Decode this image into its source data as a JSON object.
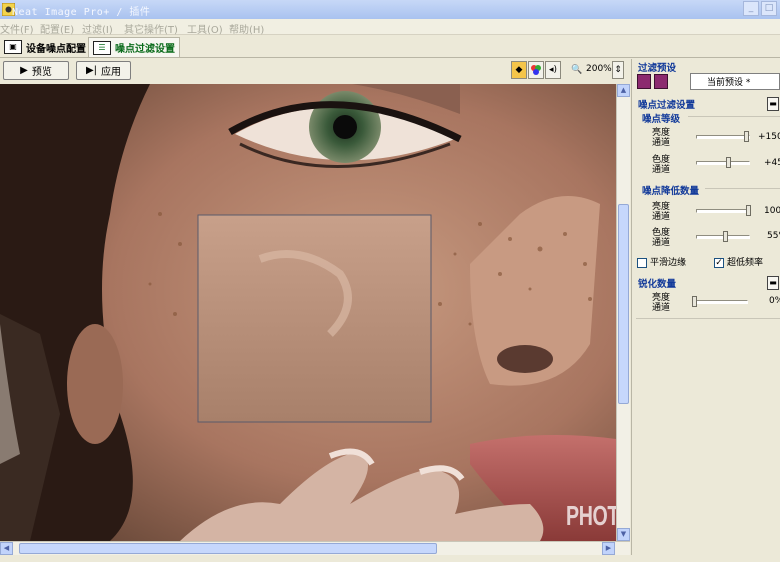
{
  "window": {
    "title": "Neat Image Pro+ / 插件",
    "minimize": "_",
    "maximize": "□"
  },
  "menu": [
    "文件(F)",
    "配置(E)",
    "过滤(I)",
    "其它操作(T)",
    "工具(O)",
    "帮助(H)"
  ],
  "tabs": [
    {
      "label": "设备噪点配置",
      "active": false
    },
    {
      "label": "噪点过滤设置",
      "active": true
    }
  ],
  "toolbar": {
    "preview_label": "预览",
    "apply_label": "应用",
    "zoom": "200%"
  },
  "panel": {
    "preset_title": "过滤预设",
    "preset_value": "当前预设 *",
    "filter_title": "噪点过滤设置",
    "noise_level_title": "噪点等级",
    "noise_level": [
      {
        "label": "亮度\n通道",
        "value_text": "+150%",
        "position": 0.9
      },
      {
        "label": "色度\n通道",
        "value_text": "+45%",
        "position": 0.55
      }
    ],
    "noise_reduction_title": "噪点降低数量",
    "noise_reduction": [
      {
        "label": "亮度\n通道",
        "value_text": "100%",
        "position": 0.95
      },
      {
        "label": "色度\n通道",
        "value_text": "55%",
        "position": 0.52
      }
    ],
    "smooth_edges": {
      "label": "平滑边缘",
      "checked": false
    },
    "ultra_low_freq": {
      "label": "超低频率",
      "checked": true
    },
    "sharpen_title": "锐化数量",
    "sharpen": [
      {
        "label": "亮度\n通道",
        "value_text": "0%",
        "position": 0.0
      }
    ]
  },
  "watermark": "PHOTOPS.COM",
  "colors": {
    "section_blue": "#123a9a",
    "active_tab_green": "#0a6b1b",
    "preset_purple": "#8c2a6f"
  }
}
